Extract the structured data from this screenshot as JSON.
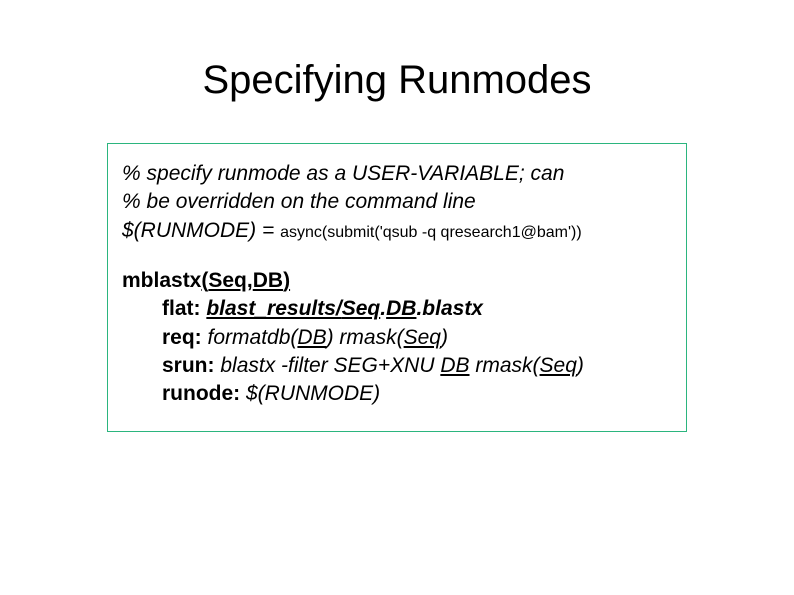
{
  "title": "Specifying Runmodes",
  "comment1_pct": "%",
  "comment1_rest": " specify runmode as a USER-VARIABLE; can",
  "comment2_pct": "%",
  "comment2_rest": " be overridden on the command line",
  "runmode_lhs": "$(RUNMODE) = ",
  "runmode_rhs": "async(submit('qsub -q qresearch1@bam'))",
  "rule_name": "mblastx",
  "rule_open": "(",
  "rule_arg1": "Seq",
  "rule_sep": ",",
  "rule_arg2": "DB",
  "rule_close": ")",
  "flat_key": "flat:",
  "flat_sp": " ",
  "flat_prefix": "blast_results/",
  "flat_seq": "Seq",
  "flat_dot1": ".",
  "flat_db": "DB",
  "flat_dot2": ".",
  "flat_suffix": "blastx",
  "req_key": "req:",
  "req_sp": " ",
  "req_fn1": "formatdb(",
  "req_db": "DB",
  "req_fn1_close": ") ",
  "req_fn2": "rmask(",
  "req_seq": "Seq",
  "req_fn2_close": ")",
  "srun_key": "srun:",
  "srun_sp": " ",
  "srun_cmd": "blastx -filter SEG+XNU ",
  "srun_db": "DB",
  "srun_sp2": " ",
  "srun_fn": "rmask(",
  "srun_seq": "Seq",
  "srun_fn_close": ")",
  "runode_key": "runode:",
  "runode_sp": " ",
  "runode_val": "$(RUNMODE)"
}
